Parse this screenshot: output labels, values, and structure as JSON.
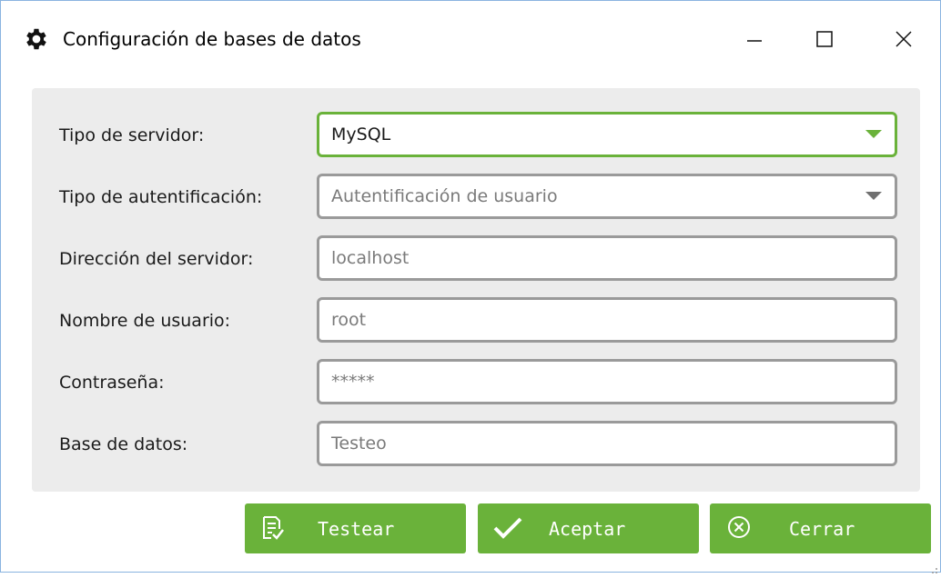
{
  "window": {
    "title": "Configuración de bases de datos",
    "title_icon": "gear-icon",
    "controls": [
      "minimize-icon",
      "maximize-icon",
      "close-icon"
    ]
  },
  "form": {
    "server_type": {
      "label": "Tipo de servidor:",
      "value": "MySQL"
    },
    "auth_type": {
      "label": "Tipo de autentificación:",
      "value": "Autentificación de usuario"
    },
    "server_address": {
      "label": "Dirección del servidor:",
      "value": "localhost"
    },
    "username": {
      "label": "Nombre de usuario:",
      "value": "root"
    },
    "password": {
      "label": "Contraseña:",
      "value": "*****"
    },
    "database": {
      "label": "Base de datos:",
      "value": "Testeo"
    }
  },
  "buttons": {
    "test": {
      "label": "Testear",
      "icon": "checklist-icon"
    },
    "accept": {
      "label": "Aceptar",
      "icon": "checkmark-icon"
    },
    "close": {
      "label": "Cerrar",
      "icon": "circle-x-icon"
    }
  },
  "colors": {
    "accent": "#6ab23a",
    "panel": "#ececec",
    "field_border": "#9a9a9a"
  }
}
